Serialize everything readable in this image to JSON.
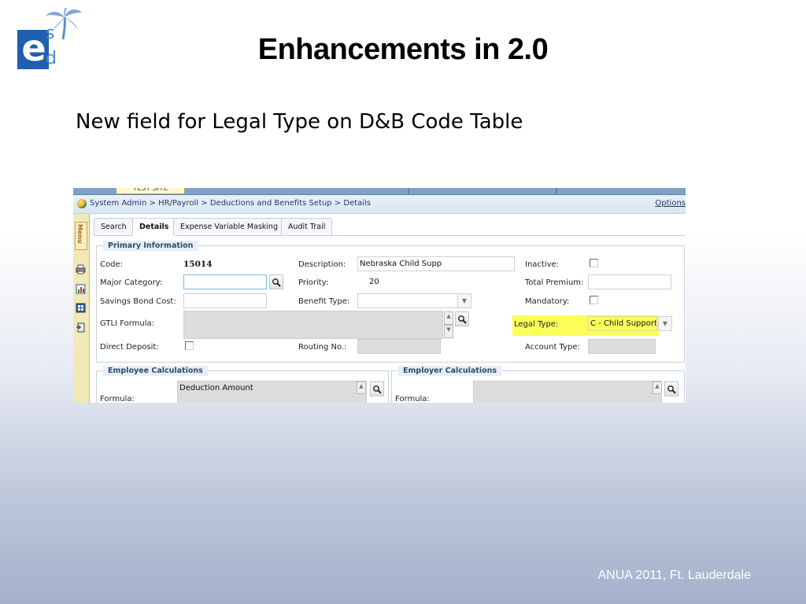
{
  "slide": {
    "title": "Enhancements in 2.0",
    "subtitle": "New field for Legal Type on D&B Code Table",
    "footer": "ANUA 2011, Ft. Lauderdale",
    "logo": {
      "letter_e": "e",
      "letter_s": "s",
      "letter_d": "d"
    }
  },
  "app": {
    "site_badge": "TEST SITE",
    "breadcrumb": "System Admin > HR/Payroll > Deductions and Benefits Setup > Details",
    "options_link": "Options",
    "menu_label": "Menu",
    "tabs": [
      {
        "label": "Search",
        "active": false
      },
      {
        "label": "Details",
        "active": true
      },
      {
        "label": "Expense Variable Masking",
        "active": false
      },
      {
        "label": "Audit Trail",
        "active": false
      }
    ],
    "primary_info": {
      "legend": "Primary Information",
      "code_label": "Code:",
      "code_value": "15014",
      "major_category_label": "Major Category:",
      "major_category_value": "",
      "savings_bond_label": "Savings Bond Cost:",
      "savings_bond_value": "",
      "gtli_label": "GTLI Formula:",
      "direct_deposit_label": "Direct Deposit:",
      "direct_deposit_checked": false,
      "description_label": "Description:",
      "description_value": "Nebraska Child Supp",
      "priority_label": "Priority:",
      "priority_value": "20",
      "benefit_type_label": "Benefit Type:",
      "benefit_type_value": "",
      "routing_label": "Routing No.:",
      "routing_value": "",
      "inactive_label": "Inactive:",
      "inactive_checked": false,
      "total_premium_label": "Total Premium:",
      "total_premium_value": "",
      "mandatory_label": "Mandatory:",
      "mandatory_checked": false,
      "legal_type_label": "Legal Type:",
      "legal_type_value": "C - Child Support",
      "account_type_label": "Account Type:",
      "account_type_value": ""
    },
    "employee_calc": {
      "legend": "Employee Calculations",
      "formula_label": "Formula:",
      "formula_value": "Deduction Amount"
    },
    "employer_calc": {
      "legend": "Employer Calculations",
      "formula_label": "Formula:",
      "formula_value": ""
    }
  },
  "colors": {
    "highlight": "#fbff3c",
    "legend_text": "#2c4a6e",
    "breadcrumb_bar": "#dfe9f5",
    "logo_blue": "#1f5fae"
  }
}
